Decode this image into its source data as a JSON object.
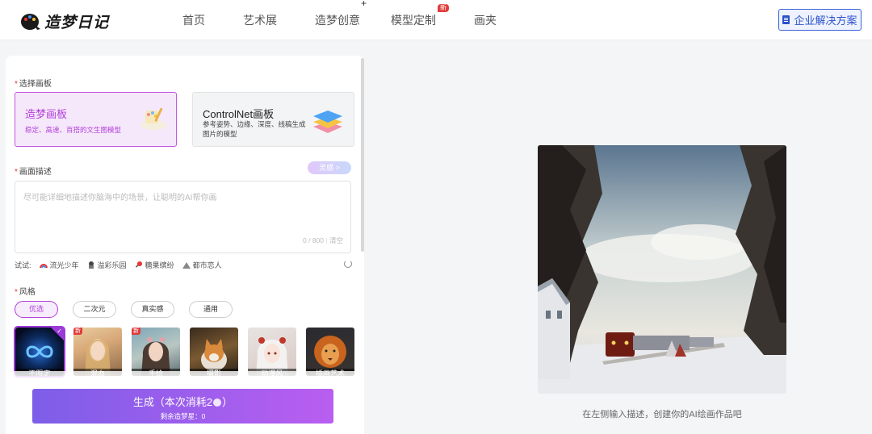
{
  "app": {
    "logo_text": "造梦日记"
  },
  "nav": {
    "items": [
      {
        "label": "首页"
      },
      {
        "label": "艺术展"
      },
      {
        "label": "造梦创意",
        "sup": "+"
      },
      {
        "label": "模型定制",
        "badge": "新"
      },
      {
        "label": "画夹"
      }
    ],
    "enterprise_label": "企业解决方案"
  },
  "board_section": {
    "label": "选择画板",
    "boards": [
      {
        "title": "造梦画板",
        "desc": "稳定、高速、百搭的文生图模型",
        "selected": true
      },
      {
        "title": "ControlNet画板",
        "desc": "参考姿势、边缘、深度、线稿生成图片的模型",
        "selected": false
      }
    ]
  },
  "prompt_section": {
    "label": "画面描述",
    "inspire_label": "灵感 >",
    "placeholder": "尽可能详细地描述你脑海中的场景，让聪明的AI帮你画",
    "counter": "0 / 800",
    "clear_label": "清空"
  },
  "try_row": {
    "label": "试试:",
    "suggestions": [
      {
        "label": "流光少年",
        "icon": "rainbow-icon"
      },
      {
        "label": "溢彩乐园",
        "icon": "character-icon"
      },
      {
        "label": "糖果缤纷",
        "icon": "candy-icon"
      },
      {
        "label": "都市恋人",
        "icon": "city-icon"
      }
    ]
  },
  "style_section": {
    "label": "风格",
    "tabs": [
      "优选",
      "二次元",
      "真实感",
      "通用"
    ],
    "active_tab": 0,
    "thumbnails": [
      {
        "label": "不限定",
        "badge": "",
        "selected": true
      },
      {
        "label": "混血",
        "badge": "新",
        "selected": false
      },
      {
        "label": "手绘",
        "badge": "新",
        "selected": false
      },
      {
        "label": "摄影",
        "badge": "",
        "selected": false
      },
      {
        "label": "动漫风",
        "badge": "",
        "selected": false
      },
      {
        "label": "插画艺术",
        "badge": "",
        "selected": false
      }
    ]
  },
  "generate": {
    "label_prefix": "生成（本次消耗2",
    "label_suffix": "）",
    "remaining": "剩余造梦星：0"
  },
  "preview": {
    "hint": "在左侧输入描述，创建你的AI绘画作品吧"
  },
  "colors": {
    "accent_purple": "#b23ed8",
    "enterprise_blue": "#2c52c9",
    "badge_red": "#e23b3b",
    "generate_gradient_start": "#7d5ee8",
    "generate_gradient_end": "#b95ef0"
  }
}
